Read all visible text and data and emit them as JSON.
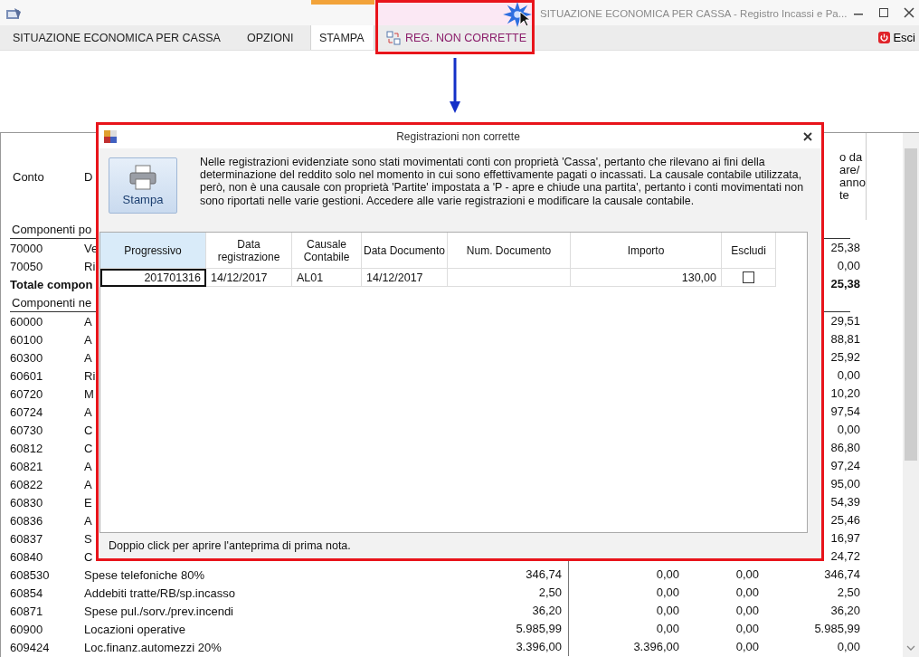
{
  "window": {
    "title": "SITUAZIONE ECONOMICA PER CASSA - Registro Incassi e Pa..."
  },
  "menu": [
    {
      "label": "SITUAZIONE ECONOMICA PER CASSA",
      "selected": false,
      "kind": "plain"
    },
    {
      "label": "OPZIONI",
      "selected": false,
      "kind": "plain"
    },
    {
      "label": "STAMPA",
      "selected": true,
      "kind": "plain"
    },
    {
      "label": "REG. NON CORRETTE",
      "selected": false,
      "kind": "context"
    }
  ],
  "exit_button": "Esci",
  "table": {
    "header": {
      "conto": "Conto",
      "description": "D",
      "last": [
        "o da",
        "are/",
        "anno",
        "te"
      ]
    },
    "rows": [
      {
        "kind": "section",
        "description": "Componenti po"
      },
      {
        "kind": "account",
        "code": "70000",
        "description": "Ve",
        "amounts": [
          "25,38"
        ]
      },
      {
        "kind": "account",
        "code": "70050",
        "description": "Ri",
        "amounts": [
          "0,00"
        ]
      },
      {
        "kind": "total",
        "description": "Totale compon",
        "amounts": [
          "25,38"
        ]
      },
      {
        "kind": "section",
        "description": "Componenti ne"
      },
      {
        "kind": "account",
        "code": "60000",
        "description": "A",
        "amounts": [
          "29,51"
        ]
      },
      {
        "kind": "account",
        "code": "60100",
        "description": "A",
        "amounts": [
          "88,81"
        ]
      },
      {
        "kind": "account",
        "code": "60300",
        "description": "A",
        "amounts": [
          "25,92"
        ]
      },
      {
        "kind": "account",
        "code": "60601",
        "description": "Ri",
        "amounts": [
          "0,00"
        ]
      },
      {
        "kind": "account",
        "code": "60720",
        "description": "M",
        "amounts": [
          "10,20"
        ]
      },
      {
        "kind": "account",
        "code": "60724",
        "description": "A",
        "amounts": [
          "97,54"
        ]
      },
      {
        "kind": "account",
        "code": "60730",
        "description": "C",
        "amounts": [
          "0,00"
        ]
      },
      {
        "kind": "account",
        "code": "60812",
        "description": "C",
        "amounts": [
          "86,80"
        ]
      },
      {
        "kind": "account",
        "code": "60821",
        "description": "A",
        "amounts": [
          "97,24"
        ]
      },
      {
        "kind": "account",
        "code": "60822",
        "description": "A",
        "amounts": [
          "95,00"
        ]
      },
      {
        "kind": "account",
        "code": "60830",
        "description": "E",
        "amounts": [
          "54,39"
        ]
      },
      {
        "kind": "account",
        "code": "60836",
        "description": "A",
        "amounts": [
          "25,46"
        ]
      },
      {
        "kind": "account",
        "code": "60837",
        "description": "S",
        "amounts": [
          "16,97"
        ]
      },
      {
        "kind": "account",
        "code": "60840",
        "description": "C",
        "amounts": [
          "24,72"
        ]
      },
      {
        "kind": "account",
        "code": "608530",
        "description": "Spese telefoniche 80%",
        "amounts": [
          "346,74",
          "0,00",
          "0,00",
          "346,74"
        ]
      },
      {
        "kind": "account",
        "code": "60854",
        "description": "Addebiti tratte/RB/sp.incasso",
        "amounts": [
          "2,50",
          "0,00",
          "0,00",
          "2,50"
        ]
      },
      {
        "kind": "account",
        "code": "60871",
        "description": "Spese pul./sorv./prev.incendi",
        "amounts": [
          "36,20",
          "0,00",
          "0,00",
          "36,20"
        ]
      },
      {
        "kind": "account",
        "code": "60900",
        "description": "Locazioni operative",
        "amounts": [
          "5.985,99",
          "0,00",
          "0,00",
          "5.985,99"
        ]
      },
      {
        "kind": "account",
        "code": "609424",
        "description": "Loc.finanz.automezzi 20%",
        "amounts": [
          "3.396,00",
          "3.396,00",
          "0,00",
          "0,00"
        ]
      }
    ]
  },
  "dialog": {
    "title": "Registrazioni non corrette",
    "print_button": "Stampa",
    "message": "Nelle registrazioni evidenziate sono stati movimentati conti con proprietà 'Cassa', pertanto che rilevano ai fini della determinazione del reddito solo nel momento in cui sono effettivamente pagati o incassati. La causale contabile utilizzata, però, non è una causale con proprietà 'Partite' impostata a 'P - apre e chiude una partita', pertanto i conti movimentati non sono riportati nelle varie gestioni. Accedere alle varie registrazioni e modificare la causale contabile.",
    "columns": [
      {
        "label": "Progressivo",
        "selected": true
      },
      {
        "label": "Data registrazione",
        "selected": false
      },
      {
        "label": "Causale Contabile",
        "selected": false
      },
      {
        "label": "Data Documento",
        "selected": false
      },
      {
        "label": "Num. Documento",
        "selected": false
      },
      {
        "label": "Importo",
        "selected": false
      },
      {
        "label": "Escludi",
        "selected": false
      }
    ],
    "rows": [
      {
        "progressivo": "201701316",
        "data_registrazione": "14/12/2017",
        "causale": "AL01",
        "data_documento": "14/12/2017",
        "importo": "130,00",
        "escludi": false
      }
    ],
    "status": "Doppio click per aprire l'anteprima di prima nota."
  }
}
